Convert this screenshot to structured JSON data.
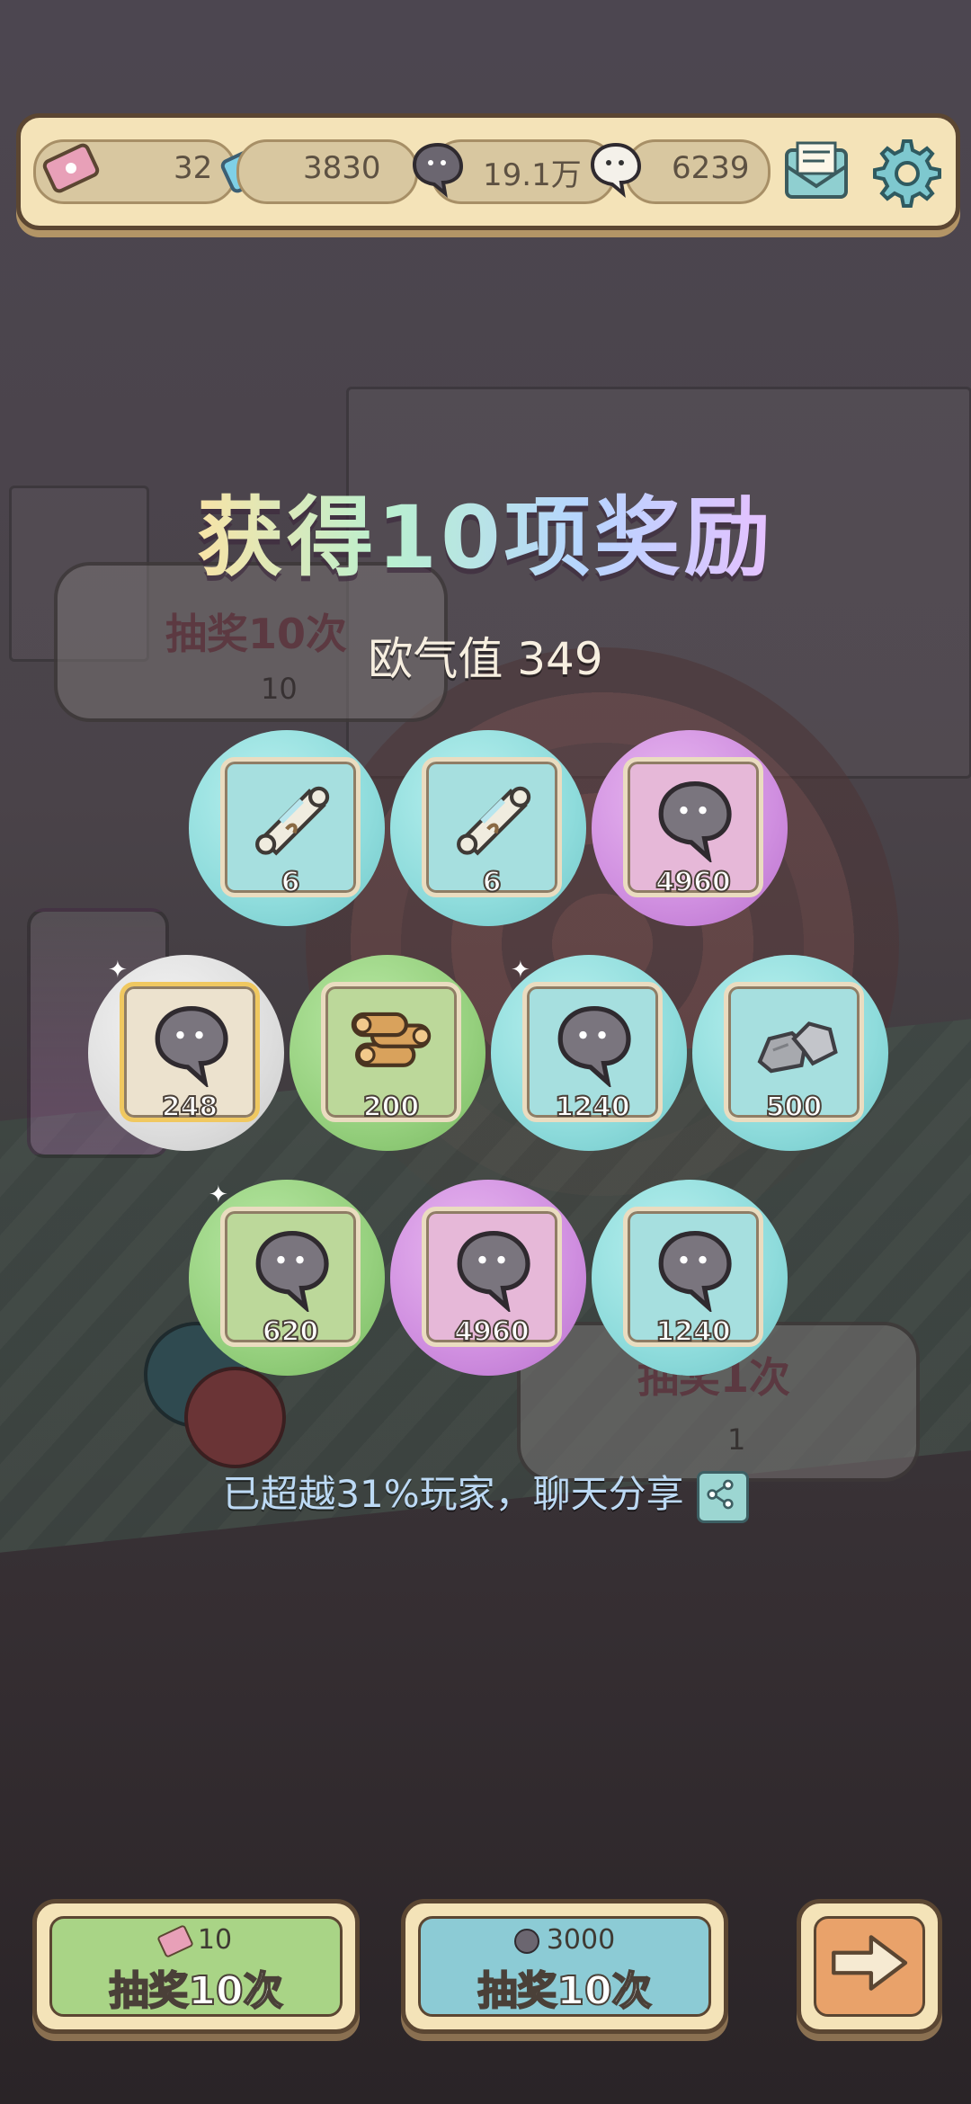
{
  "topbar": {
    "tickets": "32",
    "stars": "3830",
    "gray_bubbles": "19.1万",
    "white_bubbles": "6239",
    "icons": [
      "ticket-icon",
      "star-ticket-icon",
      "gray-bubble-icon",
      "white-bubble-icon",
      "mail-icon",
      "gear-icon"
    ]
  },
  "title": "获得10项奖励",
  "luck": "欧气值 349",
  "background_cards": {
    "left_title": "抽奖10次",
    "left_cost": "10",
    "right_title": "抽奖1次",
    "right_cost": "1"
  },
  "rewards": [
    {
      "qty": "6",
      "item": "scroll-icon",
      "rarity": "cyan"
    },
    {
      "qty": "6",
      "item": "scroll-icon",
      "rarity": "cyan"
    },
    {
      "qty": "4960",
      "item": "gray-bubble-icon",
      "rarity": "purple"
    },
    {
      "qty": "248",
      "item": "gray-bubble-icon",
      "rarity": "white"
    },
    {
      "qty": "200",
      "item": "wood-logs-icon",
      "rarity": "green"
    },
    {
      "qty": "1240",
      "item": "gray-bubble-icon",
      "rarity": "cyan"
    },
    {
      "qty": "500",
      "item": "stones-icon",
      "rarity": "cyan"
    },
    {
      "qty": "620",
      "item": "gray-bubble-icon",
      "rarity": "green"
    },
    {
      "qty": "4960",
      "item": "gray-bubble-icon",
      "rarity": "purple"
    },
    {
      "qty": "1240",
      "item": "gray-bubble-icon",
      "rarity": "cyan"
    }
  ],
  "share_text": "已超越31%玩家，聊天分享",
  "buttons": {
    "left_cost": "10",
    "left_label": "抽奖10次",
    "mid_cost": "3000",
    "mid_label": "抽奖10次"
  },
  "colors": {
    "cyan": "#8fdcdc",
    "purple": "#d08fe0",
    "green": "#96d07e",
    "white": "#dedede"
  }
}
